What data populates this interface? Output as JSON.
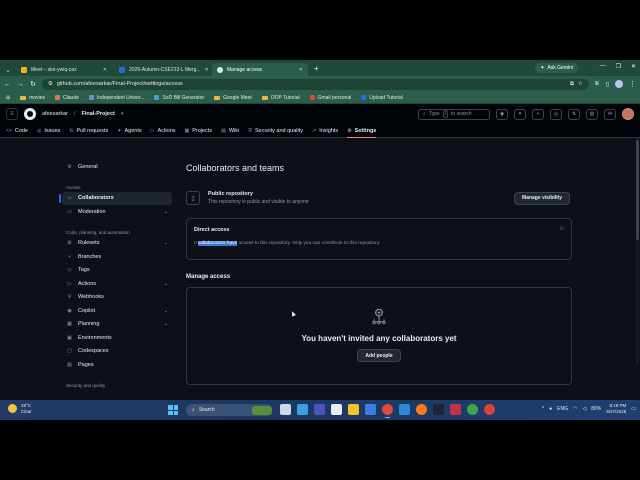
{
  "browser": {
    "tabs": [
      {
        "label": "Meet – ske-ywiq-caz",
        "color": "#f2b01e",
        "active": false
      },
      {
        "label": "2026-Autumn-CSE213-L Merg...",
        "color": "#2b6cd4",
        "active": false
      },
      {
        "label": "Manage access",
        "color": "#e6edf3",
        "active": true
      }
    ],
    "ask_gemini": "Ask Gemini",
    "url": "github.com/afeesarkar/Final-Project/settings/access",
    "bookmarks": [
      {
        "label": "movies",
        "type": "folder"
      },
      {
        "label": "Claude",
        "type": "site",
        "color": "#d97757"
      },
      {
        "label": "Independent Univer...",
        "type": "site",
        "color": "#6b8fd6"
      },
      {
        "label": "SoD Bill Generator",
        "type": "site",
        "color": "#4a9bd9"
      },
      {
        "label": "Google Meet",
        "type": "folder"
      },
      {
        "label": "OOP Tutorial",
        "type": "folder"
      },
      {
        "label": "Gmail personal",
        "type": "site",
        "color": "#ea4335"
      },
      {
        "label": "Upload Tutorial",
        "type": "site",
        "color": "#1a73e8"
      }
    ]
  },
  "github": {
    "owner": "afeesarkar",
    "repo": "Final-Project",
    "search_prefix": "Type",
    "search_key": "/",
    "search_suffix": "to search",
    "repo_tabs": [
      {
        "label": "Code",
        "icon": "<>",
        "selected": false
      },
      {
        "label": "Issues",
        "icon": "◎",
        "selected": false
      },
      {
        "label": "Pull requests",
        "icon": "⇅",
        "selected": false
      },
      {
        "label": "Agents",
        "icon": "✦",
        "selected": false
      },
      {
        "label": "Actions",
        "icon": "▷",
        "selected": false
      },
      {
        "label": "Projects",
        "icon": "▦",
        "selected": false
      },
      {
        "label": "Wiki",
        "icon": "▤",
        "selected": false
      },
      {
        "label": "Security and quality",
        "icon": "⛨",
        "selected": false
      },
      {
        "label": "Insights",
        "icon": "↗",
        "selected": false
      },
      {
        "label": "Settings",
        "icon": "⚙",
        "selected": true
      }
    ]
  },
  "sidebar": {
    "general": "General",
    "section_access": "Access",
    "collaborators": "Collaborators",
    "moderation": "Moderation",
    "section_code": "Code, planning, and automation",
    "items": [
      {
        "label": "Rulesets",
        "icon": "⊞",
        "chevron": true
      },
      {
        "label": "Branches",
        "icon": "⑂",
        "chevron": false
      },
      {
        "label": "Tags",
        "icon": "◇",
        "chevron": false
      },
      {
        "label": "Actions",
        "icon": "▷",
        "chevron": true
      },
      {
        "label": "Webhooks",
        "icon": "⚲",
        "chevron": false
      },
      {
        "label": "Copilot",
        "icon": "◉",
        "chevron": true
      },
      {
        "label": "Planning",
        "icon": "▦",
        "chevron": true
      },
      {
        "label": "Environments",
        "icon": "▣",
        "chevron": false
      },
      {
        "label": "Codespaces",
        "icon": "▢",
        "chevron": false
      },
      {
        "label": "Pages",
        "icon": "▤",
        "chevron": false
      }
    ],
    "section_security": "Security and quality"
  },
  "main": {
    "title": "Collaborators and teams",
    "repo_visibility_title": "Public repository",
    "repo_visibility_desc": "This repository is public and visible to anyone",
    "manage_visibility": "Manage visibility",
    "direct_access_title": "Direct access",
    "direct_access_count": "0",
    "direct_access_highlight": "collaborators have",
    "direct_access_rest": "access to this repository. Only you can contribute to this repository.",
    "manage_access_title": "Manage access",
    "empty_title": "You haven't invited any collaborators yet",
    "add_people": "Add people"
  },
  "taskbar": {
    "temp": "28°C",
    "weather": "Clear",
    "search": "Search",
    "lang": "ENG",
    "battery": "80%",
    "time": "8:18 PM",
    "date": "9/27/2026"
  }
}
